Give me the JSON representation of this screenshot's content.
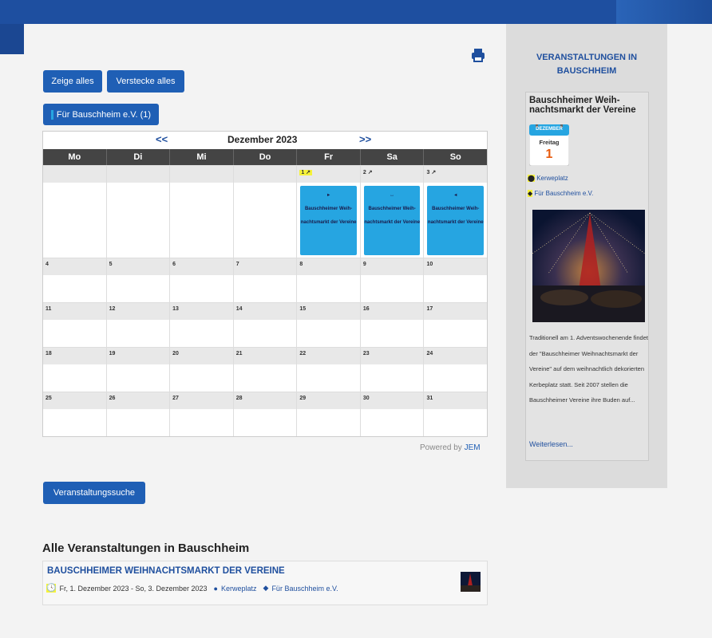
{
  "buttons": {
    "show_all": "Zeige alles",
    "hide_all": "Verstecke alles",
    "filter": "Für Bauschheim e.V. (1)",
    "search": "Veranstaltungssuche"
  },
  "calendar": {
    "prev": "<<",
    "next": ">>",
    "month": "Dezember 2023",
    "weekdays": [
      "Mo",
      "Di",
      "Mi",
      "Do",
      "Fr",
      "Sa",
      "So"
    ],
    "weeks": [
      [
        "",
        "",
        "",
        "",
        "1",
        "2",
        "3"
      ],
      [
        "4",
        "5",
        "6",
        "7",
        "8",
        "9",
        "10"
      ],
      [
        "11",
        "12",
        "13",
        "14",
        "15",
        "16",
        "17"
      ],
      [
        "18",
        "19",
        "20",
        "21",
        "22",
        "23",
        "24"
      ],
      [
        "25",
        "26",
        "27",
        "28",
        "29",
        "30",
        "31"
      ]
    ],
    "event_title": "Bauschheimer Weih-nachtsmarkt der Vereine",
    "powered_prefix": "Powered by ",
    "powered_link": "JEM"
  },
  "sidebar": {
    "title": "VERANSTALTUNGEN IN BAUSCHHEIM",
    "event_title": "Bauschheimer Weih-nachtsmarkt der Vereine",
    "cal_month": "DEZEMBER",
    "cal_weekday": "Freitag",
    "cal_day": "1",
    "venue": "Kerweplatz",
    "category": "Für Bauschheim e.V.",
    "description": "Traditionell am 1. Adventswochenende findet der \"Bauschheimer Weihnachtsmarkt der Vereine\" auf dem weihnachtlich dekorierten Kerbeplatz statt. Seit 2007 stellen die Bauschheimer Vereine ihre Buden auf...",
    "more": "Weiterlesen..."
  },
  "list": {
    "title": "Alle Veranstaltungen in Bauschheim",
    "event": "BAUSCHHEIMER WEIHNACHTSMARKT DER VEREINE",
    "date": "Fr, 1. Dezember 2023 - So, 3. Dezember 2023",
    "venue": "Kerweplatz",
    "category": "Für Bauschheim e.V."
  },
  "colors": {
    "accent": "#1f5fb5",
    "event": "#26a5e1",
    "highlight": "#f5f23a"
  }
}
